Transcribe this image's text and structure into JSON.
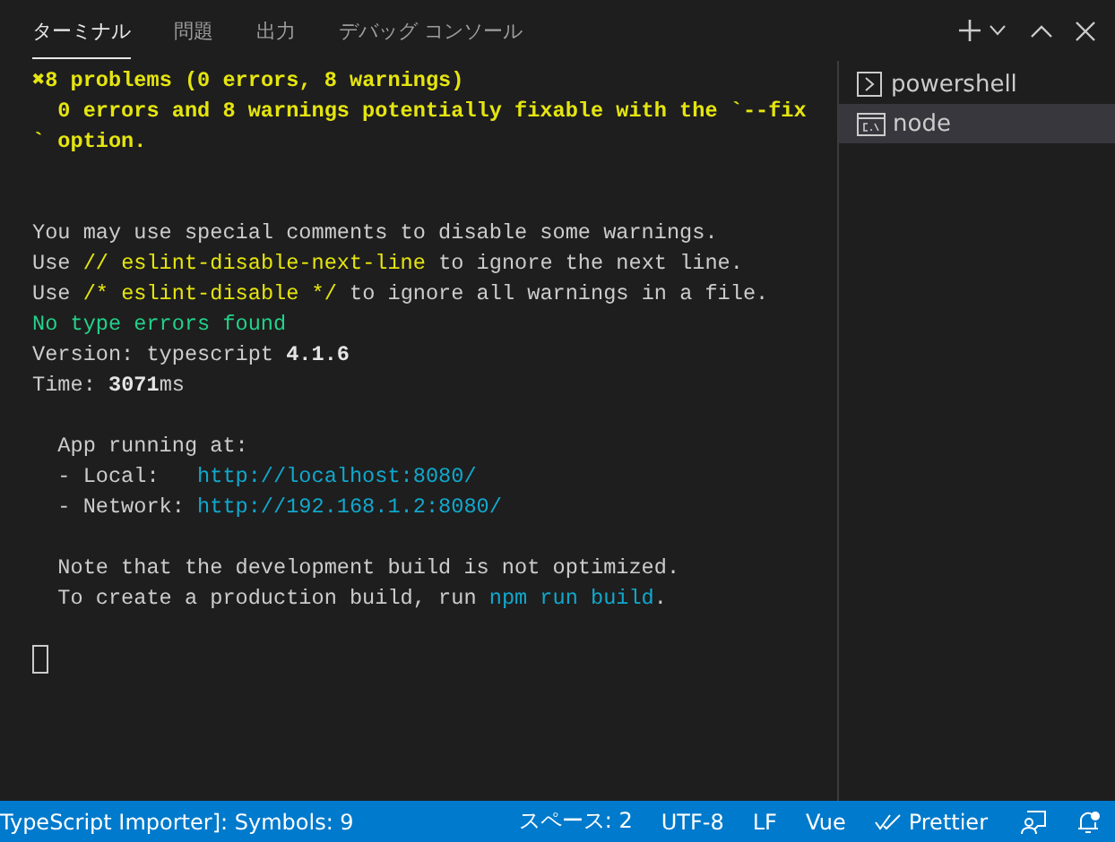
{
  "tabs": [
    {
      "label": "ターミナル",
      "selected": true
    },
    {
      "label": "問題",
      "selected": false
    },
    {
      "label": "出力",
      "selected": false
    },
    {
      "label": "デバッグ コンソール",
      "selected": false
    }
  ],
  "terminal": {
    "blocks": [
      {
        "lines": [
          [
            {
              "kind": "yellow",
              "text": "✖8 problems (0 errors, 8 warnings)"
            }
          ],
          [
            {
              "kind": "yellow",
              "text": "  0 errors and 8 warnings potentially fixable with the `--fix"
            }
          ],
          [
            {
              "kind": "yellow",
              "text": "` option."
            }
          ]
        ]
      },
      {
        "lines": [
          [
            {
              "kind": "plain",
              "text": "You may use special comments to disable some warnings."
            }
          ],
          [
            {
              "kind": "plain",
              "text": "Use "
            },
            {
              "kind": "accent",
              "text": "// eslint-disable-next-line"
            },
            {
              "kind": "plain",
              "text": " to ignore the next line."
            }
          ],
          [
            {
              "kind": "plain",
              "text": "Use "
            },
            {
              "kind": "accent",
              "text": "/* eslint-disable */"
            },
            {
              "kind": "plain",
              "text": " to ignore all warnings in a file."
            }
          ],
          [
            {
              "kind": "green",
              "text": "No type errors found"
            }
          ],
          [
            {
              "kind": "plain",
              "text": "Version: typescript "
            },
            {
              "kind": "bold",
              "text": "4.1.6"
            }
          ],
          [
            {
              "kind": "plain",
              "text": "Time: "
            },
            {
              "kind": "bold",
              "text": "3071"
            },
            {
              "kind": "plain",
              "text": "ms"
            }
          ]
        ]
      },
      {
        "lines": [
          [
            {
              "kind": "plain",
              "text": "  App running at:"
            }
          ],
          [
            {
              "kind": "plain",
              "text": "  - Local:   "
            },
            {
              "kind": "link",
              "text": "http://localhost:8080/"
            }
          ],
          [
            {
              "kind": "plain",
              "text": "  - Network: "
            },
            {
              "kind": "link",
              "text": "http://192.168.1.2:8080/"
            }
          ]
        ]
      },
      {
        "lines": [
          [
            {
              "kind": "plain",
              "text": "  Note that the development build is not optimized."
            }
          ],
          [
            {
              "kind": "plain",
              "text": "  To create a production build, run "
            },
            {
              "kind": "cyan",
              "text": "npm run build"
            },
            {
              "kind": "plain",
              "text": "."
            }
          ]
        ]
      }
    ]
  },
  "shells": [
    {
      "kind": "powershell",
      "label": "powershell",
      "selected": false
    },
    {
      "kind": "cmd",
      "label": "node",
      "selected": true
    }
  ],
  "status_bar": {
    "left": "TypeScript Importer]: Symbols: 9",
    "right": [
      "スペース: 2",
      "UTF-8",
      "LF",
      "Vue"
    ],
    "prettier": "Prettier"
  }
}
